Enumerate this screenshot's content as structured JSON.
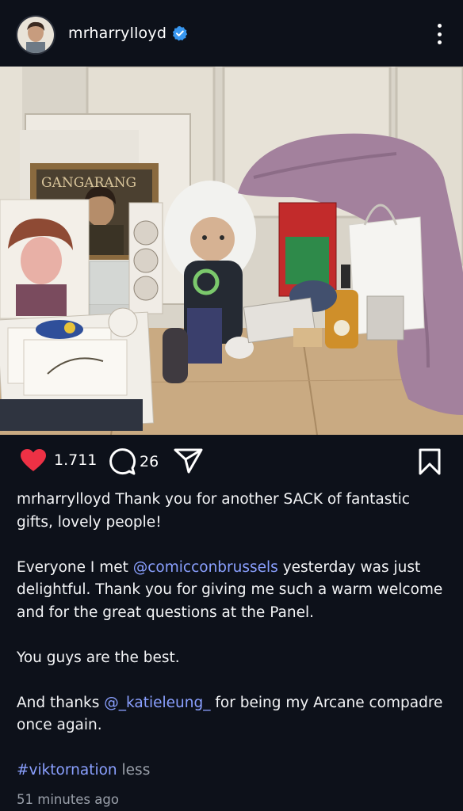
{
  "post": {
    "username": "mrharrylloyd",
    "likes": "1.711",
    "comments": "26",
    "caption": {
      "p1_user": "mrharrylloyd",
      "p1_text": " Thank you for another SACK of fantastic gifts, lovely people!",
      "p2_before": "Everyone I met ",
      "p2_mention": "@comicconbrussels",
      "p2_after": " yesterday was just delightful. Thank you for giving me such a warm welcome and for the great questions at the Panel.",
      "p3": "You guys are the best.",
      "p4_before": "And thanks ",
      "p4_mention": "@_katieleung_",
      "p4_after": "  for being my Arcane compadre once again.",
      "hashtag": "#viktornation",
      "less": " less"
    },
    "timestamp": "51 minutes ago",
    "photo_text": "GANGARANG"
  },
  "colors": {
    "background": "#0d111a",
    "like": "#ed3145",
    "mention": "#8aa0ff",
    "verified": "#3897f0"
  },
  "icons": [
    "avatar",
    "verified-badge-icon",
    "more-options-icon",
    "heart-icon",
    "comment-icon",
    "share-icon",
    "bookmark-icon"
  ]
}
